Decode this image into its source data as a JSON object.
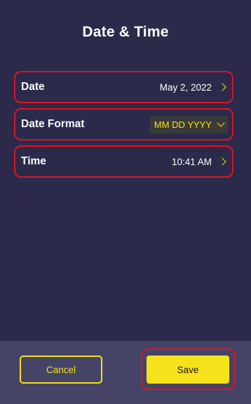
{
  "header": {
    "title": "Date & Time"
  },
  "settings": {
    "date": {
      "label": "Date",
      "value": "May 2, 2022"
    },
    "date_format": {
      "label": "Date Format",
      "value": "MM DD YYYY"
    },
    "time": {
      "label": "Time",
      "value": "10:41 AM"
    }
  },
  "footer": {
    "cancel_label": "Cancel",
    "save_label": "Save"
  },
  "icons": {
    "row_chevron": "chevron-right-icon",
    "select_chevron": "chevron-down-icon"
  },
  "colors": {
    "background": "#2b2a4a",
    "footer": "#454466",
    "accent": "#f5e21a",
    "highlight": "#e0131f"
  }
}
